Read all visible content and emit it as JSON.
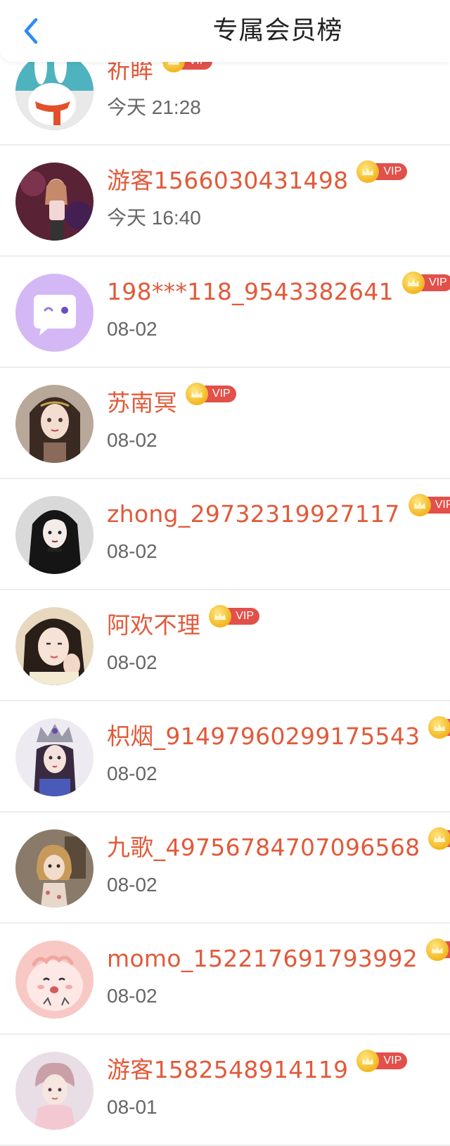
{
  "header": {
    "title": "专属会员榜"
  },
  "vip_label": "VIP",
  "colors": {
    "name": "#e15a3a",
    "date": "#666666",
    "accent": "#2d8cf0",
    "vip_badge": "#e2504a"
  },
  "members": [
    {
      "name": "祈眸",
      "date": "今天 21:28",
      "avatar": "bunny-avatar"
    },
    {
      "name": "游客1566030431498",
      "date": "今天 16:40",
      "avatar": "girl-stage-avatar"
    },
    {
      "name": "198***118_9543382641",
      "date": "08-02",
      "avatar": "chat-bubble-avatar"
    },
    {
      "name": "苏南冥",
      "date": "08-02",
      "avatar": "anime-girl-avatar"
    },
    {
      "name": "zhong_29732319927117",
      "date": "08-02",
      "avatar": "dark-hair-girl-avatar"
    },
    {
      "name": "阿欢不理",
      "date": "08-02",
      "avatar": "selfie-girl-avatar"
    },
    {
      "name": "枳烟_91497960299175543",
      "date": "08-02",
      "avatar": "crowned-doll-avatar"
    },
    {
      "name": "九歌_49756784707096568",
      "date": "08-02",
      "avatar": "vintage-doll-avatar"
    },
    {
      "name": "momo_152217691793992",
      "date": "08-02",
      "avatar": "pink-blob-avatar"
    },
    {
      "name": "游客1582548914119",
      "date": "08-01",
      "avatar": "anime-boy-avatar"
    }
  ]
}
